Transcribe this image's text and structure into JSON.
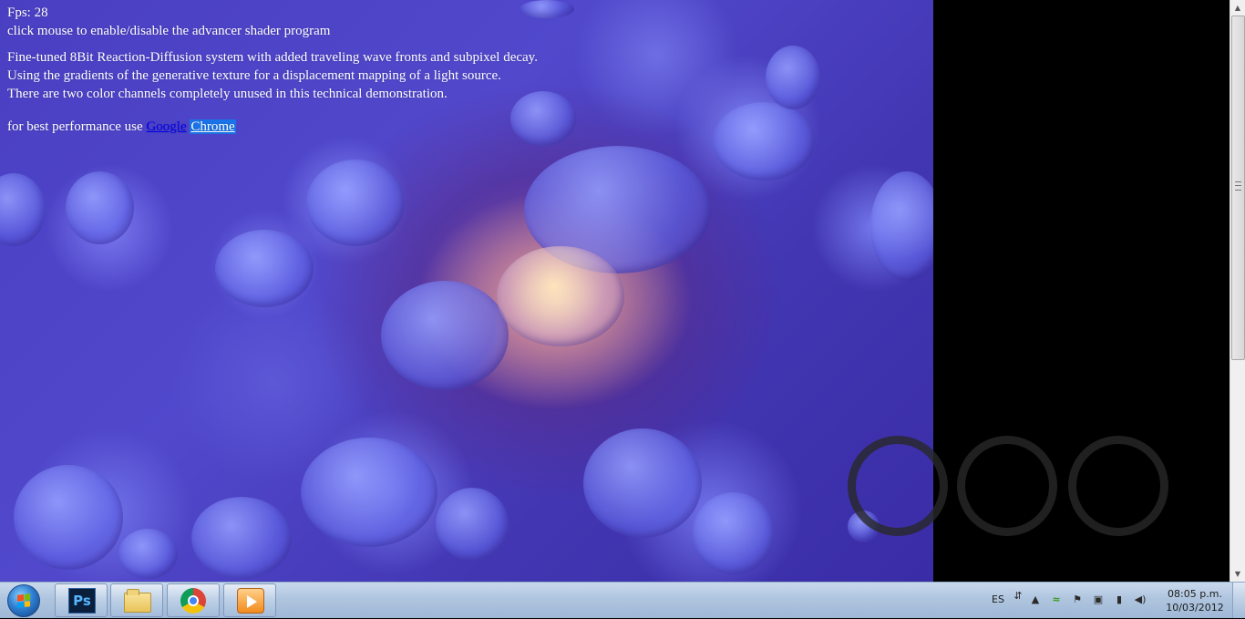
{
  "overlay": {
    "fps": "Fps: 28",
    "instruction": "click mouse to enable/disable the advancer shader program",
    "desc_line1": "Fine-tuned 8Bit Reaction-Diffusion system with added traveling wave fronts and subpixel decay.",
    "desc_line2": "Using the gradients of the generative texture for a displacement mapping of a light source.",
    "desc_line3": "There are two color channels completely unused in this technical demonstration.",
    "perf_prefix": "for best performance use ",
    "link_google": "Google",
    "link_chrome": "Chrome"
  },
  "taskbar": {
    "start_icon": "windows-start-orb",
    "apps": [
      {
        "name": "Photoshop",
        "icon": "photoshop-icon",
        "label": "Ps"
      },
      {
        "name": "Explorer",
        "icon": "folder-icon"
      },
      {
        "name": "Chrome",
        "icon": "chrome-icon"
      },
      {
        "name": "Media Player",
        "icon": "media-player-icon"
      }
    ],
    "tray": {
      "language": "ES",
      "clock_time": "08:05 p.m.",
      "clock_date": "10/03/2012"
    }
  },
  "colors": {
    "canvas_base": "#4a3fc2",
    "highlight": "#ffdcaa",
    "taskbar": "#b5c9e2",
    "link": "#0000ee",
    "selection": "#1a73e8"
  }
}
